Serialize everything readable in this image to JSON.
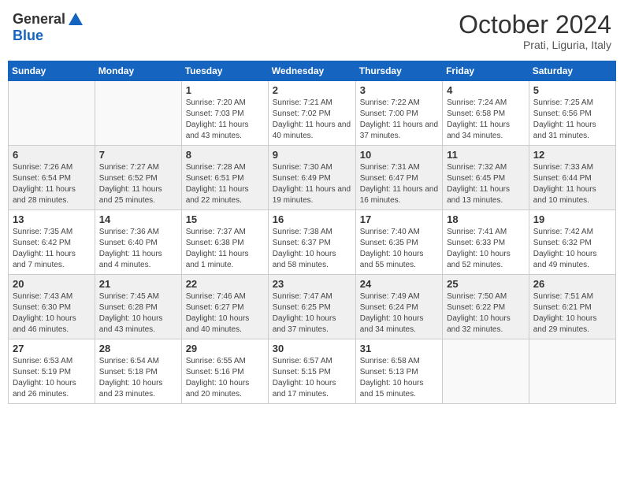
{
  "header": {
    "logo": {
      "line1": "General",
      "line2": "Blue"
    },
    "title": "October 2024",
    "subtitle": "Prati, Liguria, Italy"
  },
  "weekdays": [
    "Sunday",
    "Monday",
    "Tuesday",
    "Wednesday",
    "Thursday",
    "Friday",
    "Saturday"
  ],
  "weeks": [
    [
      {
        "day": "",
        "detail": ""
      },
      {
        "day": "",
        "detail": ""
      },
      {
        "day": "1",
        "detail": "Sunrise: 7:20 AM\nSunset: 7:03 PM\nDaylight: 11 hours and 43 minutes."
      },
      {
        "day": "2",
        "detail": "Sunrise: 7:21 AM\nSunset: 7:02 PM\nDaylight: 11 hours and 40 minutes."
      },
      {
        "day": "3",
        "detail": "Sunrise: 7:22 AM\nSunset: 7:00 PM\nDaylight: 11 hours and 37 minutes."
      },
      {
        "day": "4",
        "detail": "Sunrise: 7:24 AM\nSunset: 6:58 PM\nDaylight: 11 hours and 34 minutes."
      },
      {
        "day": "5",
        "detail": "Sunrise: 7:25 AM\nSunset: 6:56 PM\nDaylight: 11 hours and 31 minutes."
      }
    ],
    [
      {
        "day": "6",
        "detail": "Sunrise: 7:26 AM\nSunset: 6:54 PM\nDaylight: 11 hours and 28 minutes."
      },
      {
        "day": "7",
        "detail": "Sunrise: 7:27 AM\nSunset: 6:52 PM\nDaylight: 11 hours and 25 minutes."
      },
      {
        "day": "8",
        "detail": "Sunrise: 7:28 AM\nSunset: 6:51 PM\nDaylight: 11 hours and 22 minutes."
      },
      {
        "day": "9",
        "detail": "Sunrise: 7:30 AM\nSunset: 6:49 PM\nDaylight: 11 hours and 19 minutes."
      },
      {
        "day": "10",
        "detail": "Sunrise: 7:31 AM\nSunset: 6:47 PM\nDaylight: 11 hours and 16 minutes."
      },
      {
        "day": "11",
        "detail": "Sunrise: 7:32 AM\nSunset: 6:45 PM\nDaylight: 11 hours and 13 minutes."
      },
      {
        "day": "12",
        "detail": "Sunrise: 7:33 AM\nSunset: 6:44 PM\nDaylight: 11 hours and 10 minutes."
      }
    ],
    [
      {
        "day": "13",
        "detail": "Sunrise: 7:35 AM\nSunset: 6:42 PM\nDaylight: 11 hours and 7 minutes."
      },
      {
        "day": "14",
        "detail": "Sunrise: 7:36 AM\nSunset: 6:40 PM\nDaylight: 11 hours and 4 minutes."
      },
      {
        "day": "15",
        "detail": "Sunrise: 7:37 AM\nSunset: 6:38 PM\nDaylight: 11 hours and 1 minute."
      },
      {
        "day": "16",
        "detail": "Sunrise: 7:38 AM\nSunset: 6:37 PM\nDaylight: 10 hours and 58 minutes."
      },
      {
        "day": "17",
        "detail": "Sunrise: 7:40 AM\nSunset: 6:35 PM\nDaylight: 10 hours and 55 minutes."
      },
      {
        "day": "18",
        "detail": "Sunrise: 7:41 AM\nSunset: 6:33 PM\nDaylight: 10 hours and 52 minutes."
      },
      {
        "day": "19",
        "detail": "Sunrise: 7:42 AM\nSunset: 6:32 PM\nDaylight: 10 hours and 49 minutes."
      }
    ],
    [
      {
        "day": "20",
        "detail": "Sunrise: 7:43 AM\nSunset: 6:30 PM\nDaylight: 10 hours and 46 minutes."
      },
      {
        "day": "21",
        "detail": "Sunrise: 7:45 AM\nSunset: 6:28 PM\nDaylight: 10 hours and 43 minutes."
      },
      {
        "day": "22",
        "detail": "Sunrise: 7:46 AM\nSunset: 6:27 PM\nDaylight: 10 hours and 40 minutes."
      },
      {
        "day": "23",
        "detail": "Sunrise: 7:47 AM\nSunset: 6:25 PM\nDaylight: 10 hours and 37 minutes."
      },
      {
        "day": "24",
        "detail": "Sunrise: 7:49 AM\nSunset: 6:24 PM\nDaylight: 10 hours and 34 minutes."
      },
      {
        "day": "25",
        "detail": "Sunrise: 7:50 AM\nSunset: 6:22 PM\nDaylight: 10 hours and 32 minutes."
      },
      {
        "day": "26",
        "detail": "Sunrise: 7:51 AM\nSunset: 6:21 PM\nDaylight: 10 hours and 29 minutes."
      }
    ],
    [
      {
        "day": "27",
        "detail": "Sunrise: 6:53 AM\nSunset: 5:19 PM\nDaylight: 10 hours and 26 minutes."
      },
      {
        "day": "28",
        "detail": "Sunrise: 6:54 AM\nSunset: 5:18 PM\nDaylight: 10 hours and 23 minutes."
      },
      {
        "day": "29",
        "detail": "Sunrise: 6:55 AM\nSunset: 5:16 PM\nDaylight: 10 hours and 20 minutes."
      },
      {
        "day": "30",
        "detail": "Sunrise: 6:57 AM\nSunset: 5:15 PM\nDaylight: 10 hours and 17 minutes."
      },
      {
        "day": "31",
        "detail": "Sunrise: 6:58 AM\nSunset: 5:13 PM\nDaylight: 10 hours and 15 minutes."
      },
      {
        "day": "",
        "detail": ""
      },
      {
        "day": "",
        "detail": ""
      }
    ]
  ]
}
